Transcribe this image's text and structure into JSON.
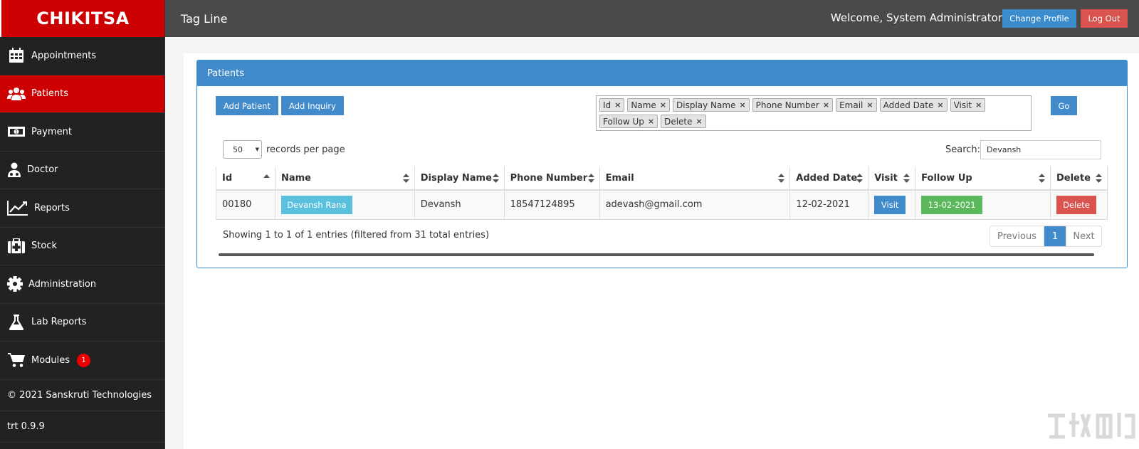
{
  "brand": "CHIKITSA",
  "topbar": {
    "tagline": "Tag Line",
    "welcome": "Welcome, System Administrator",
    "change_profile": "Change Profile",
    "logout": "Log Out"
  },
  "sidebar": {
    "items": [
      {
        "label": "Appointments",
        "icon": "calendar-icon"
      },
      {
        "label": "Patients",
        "icon": "users-icon",
        "active": true
      },
      {
        "label": "Payment",
        "icon": "money-icon"
      },
      {
        "label": "Doctor",
        "icon": "doctor-icon"
      },
      {
        "label": "Reports",
        "icon": "chart-line-icon"
      },
      {
        "label": "Stock",
        "icon": "medkit-icon"
      },
      {
        "label": "Administration",
        "icon": "gear-icon"
      },
      {
        "label": "Lab Reports",
        "icon": "flask-icon"
      },
      {
        "label": "Modules",
        "icon": "cart-icon",
        "badge": "1"
      }
    ],
    "copyright": "© 2021 Sanskruti Technologies",
    "version": "trt 0.9.9"
  },
  "panel": {
    "title": "Patients",
    "add_patient": "Add Patient",
    "add_inquiry": "Add Inquiry",
    "go": "Go",
    "column_tags": [
      "Id",
      "Name",
      "Display Name",
      "Phone Number",
      "Email",
      "Added Date",
      "Visit",
      "Follow Up",
      "Delete"
    ],
    "records_value": "50",
    "records_label": "records per page",
    "search_label": "Search:",
    "search_value": "Devansh"
  },
  "table": {
    "headers": [
      "Id",
      "Name",
      "Display Name",
      "Phone Number",
      "Email",
      "Added Date",
      "Visit",
      "Follow Up",
      "Delete"
    ],
    "rows": [
      {
        "id": "00180",
        "name": "Devansh Rana",
        "display_name": "Devansh",
        "phone": "18547124895",
        "email": "adevash@gmail.com",
        "added_date": "12-02-2021",
        "visit": "Visit",
        "follow_up": "13-02-2021",
        "delete": "Delete"
      }
    ]
  },
  "footer": {
    "showing": "Showing 1 to 1 of 1 entries (filtered from 31 total entries)",
    "previous": "Previous",
    "page": "1",
    "next": "Next"
  },
  "colors": {
    "brand_red": "#cc0000",
    "sidebar_bg": "#222222",
    "topbar_bg": "#4a4a4a",
    "primary": "#428bca",
    "info": "#5bc0de",
    "success": "#5cb85c",
    "danger": "#d9534f"
  }
}
